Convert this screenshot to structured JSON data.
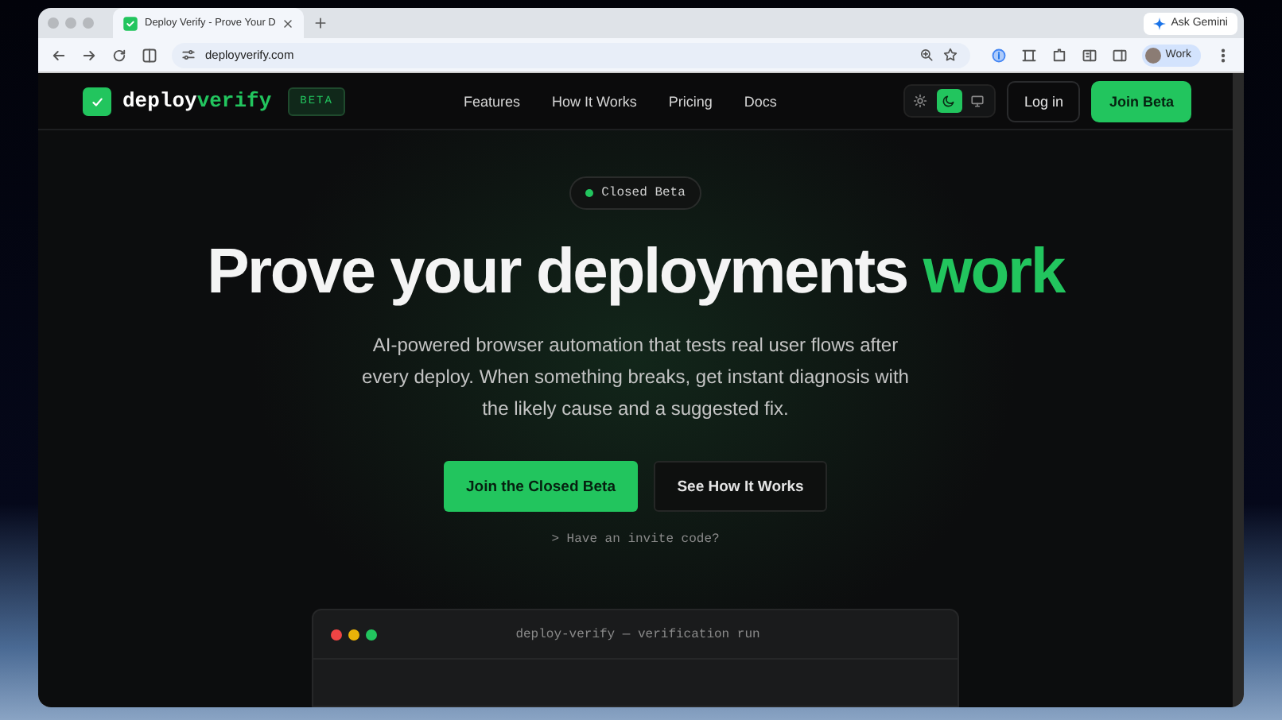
{
  "browser": {
    "tab": {
      "title": "Deploy Verify - Prove Your D",
      "selected": true
    },
    "ask_button": "Ask Gemini",
    "url": "deployverify.com",
    "profile": "Work"
  },
  "nav": {
    "logo": {
      "part1": "deploy",
      "part2": "verify"
    },
    "badge": "BETA",
    "links": [
      "Features",
      "How It Works",
      "Pricing",
      "Docs"
    ],
    "theme_options": [
      {
        "kind": "sun",
        "selected": false
      },
      {
        "kind": "moon",
        "selected": true
      },
      {
        "kind": "monitor",
        "selected": false
      }
    ],
    "login": "Log in",
    "join": "Join Beta"
  },
  "hero": {
    "pill": "Closed Beta",
    "headline": "Prove your deployments",
    "highlight": "work",
    "description": "AI-powered browser automation that tests real user flows after every deploy. When something breaks, get instant diagnosis with the likely cause and a suggested fix.",
    "primary_button": "Join the Closed Beta",
    "secondary_button": "See How It Works",
    "invite": "> Have an invite code?"
  },
  "terminal": {
    "title": "deploy-verify — verification run"
  }
}
